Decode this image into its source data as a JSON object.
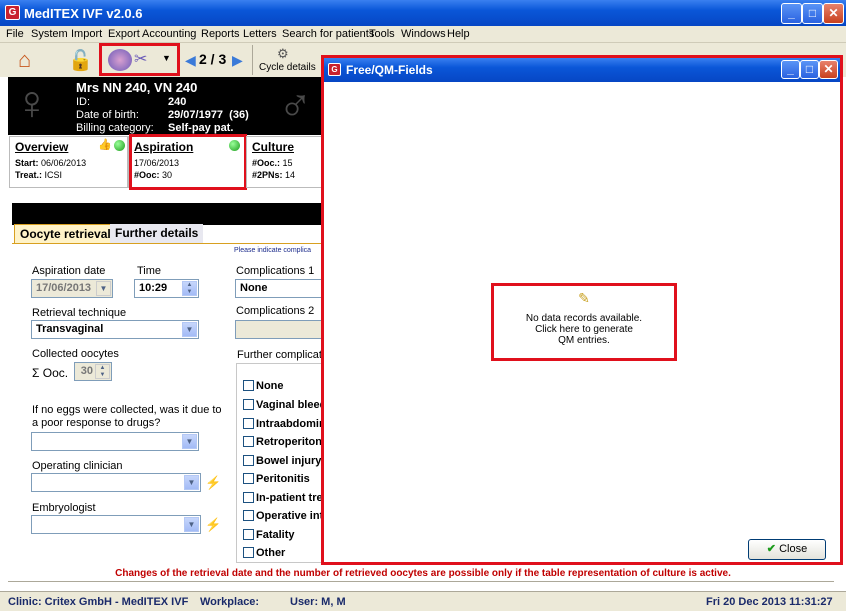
{
  "app": {
    "title": "MedITEX IVF v2.0.6"
  },
  "menu": [
    "File",
    "System",
    "Import",
    "Export",
    "Accounting",
    "Reports",
    "Letters",
    "Search for patients",
    "Tools",
    "Windows",
    "Help"
  ],
  "toolbar": {
    "pager": "2 / 3",
    "cycle_details": "Cycle details"
  },
  "patient": {
    "name": "Mrs NN 240, VN 240",
    "id_label": "ID:",
    "id": "240",
    "dob_label": "Date of birth:",
    "dob": "29/07/1977  (36)",
    "billing_label": "Billing category:",
    "billing": "Self-pay pat."
  },
  "cards": {
    "overview": {
      "title": "Overview",
      "start_label": "Start:",
      "start": "06/06/2013",
      "treat_label": "Treat.:",
      "treat": "ICSI"
    },
    "aspiration": {
      "title": "Aspiration",
      "date": "17/06/2013",
      "ooc_label": "#Ooc:",
      "ooc": "30"
    },
    "culture": {
      "title": "Culture",
      "ooc_label": "#Ooc.:",
      "ooc": "15",
      "pn_label": "#2PNs:",
      "pn": "14"
    }
  },
  "tabs": {
    "oocyte": "Oocyte retrieval",
    "further": "Further details"
  },
  "form": {
    "note": "Please indicate complica",
    "aspiration_date_label": "Aspiration date",
    "aspiration_date": "17/06/2013",
    "time_label": "Time",
    "time": "10:29",
    "retrieval_label": "Retrieval technique",
    "retrieval": "Transvaginal",
    "collected_label": "Collected oocytes",
    "sum_label": "Σ Ooc.",
    "collected": "30",
    "no_eggs_q": "If no eggs were collected, was it due to a poor response to drugs?",
    "clinician_label": "Operating clinician",
    "embryologist_label": "Embryologist",
    "comp1_label": "Complications 1",
    "comp1": "None",
    "comp2_label": "Complications 2",
    "further_label": "Further complicati",
    "checks": [
      "None",
      "Vaginal bleed",
      "Intraabdomin",
      "Retroperitone",
      "Bowel injury",
      "Peritonitis",
      "In-patient trea",
      "Operative inte",
      "Fatality",
      "Other"
    ]
  },
  "dialog": {
    "title": "Free/QM-Fields",
    "nodata_1": "No data records available.",
    "nodata_2": "Click here to generate",
    "nodata_3": "QM entries.",
    "close": "Close"
  },
  "warning": "Changes of the retrieval date and the number of retrieved oocytes are possible only if the table representation of culture is active.",
  "status": {
    "clinic": "Clinic: Critex GmbH - MedITEX IVF",
    "workplace": "Workplace:",
    "user": "User: M, M",
    "datetime": "Fri 20 Dec 2013 11:31:27"
  }
}
